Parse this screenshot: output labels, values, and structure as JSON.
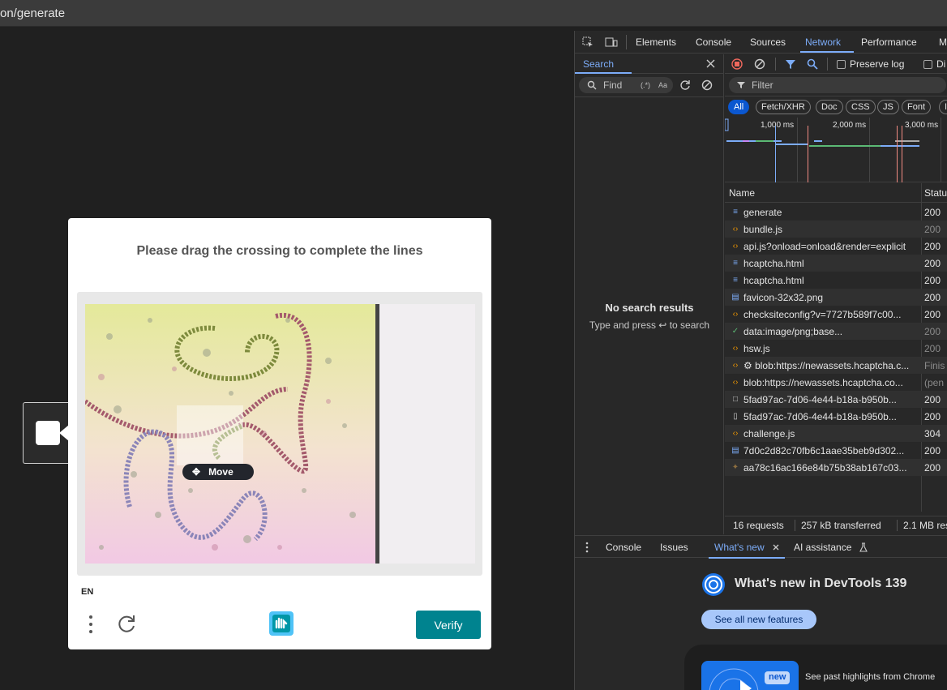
{
  "browser": {
    "url": "on/generate"
  },
  "captcha": {
    "prompt": "Please drag the crossing to complete the lines",
    "move_tooltip": "Move",
    "language": "EN",
    "verify_label": "Verify"
  },
  "devtools": {
    "tabs": [
      "Elements",
      "Console",
      "Sources",
      "Network",
      "Performance",
      "M"
    ],
    "active_tab": "Network",
    "search": {
      "title": "Search",
      "find_placeholder": "Find",
      "regex_label": "(.*)",
      "case_label": "Aa",
      "empty_title": "No search results",
      "empty_hint": "Type and press ↩ to search"
    },
    "network": {
      "preserve_log": "Preserve log",
      "disable_cache": "Di",
      "filter_placeholder": "Filter",
      "types": [
        "All",
        "Fetch/XHR",
        "Doc",
        "CSS",
        "JS",
        "Font",
        "Im"
      ],
      "timeline_labels": [
        "1,000 ms",
        "2,000 ms",
        "3,000 ms"
      ],
      "columns": {
        "name": "Name",
        "status": "Statu"
      },
      "requests": [
        {
          "name": "generate",
          "status": "200",
          "icon": "document-icon",
          "dim": false
        },
        {
          "name": "bundle.js",
          "status": "200",
          "icon": "script-icon",
          "dim": true
        },
        {
          "name": "api.js?onload=onload&render=explicit",
          "status": "200",
          "icon": "script-icon",
          "dim": false
        },
        {
          "name": "hcaptcha.html",
          "status": "200",
          "icon": "document-icon",
          "dim": false
        },
        {
          "name": "hcaptcha.html",
          "status": "200",
          "icon": "document-icon",
          "dim": false
        },
        {
          "name": "favicon-32x32.png",
          "status": "200",
          "icon": "image-icon",
          "dim": false
        },
        {
          "name": "checksiteconfig?v=7727b589f7c00...",
          "status": "200",
          "icon": "fetch-icon",
          "dim": false
        },
        {
          "name": "data:image/png;base...",
          "status": "200",
          "icon": "check-icon",
          "dim": true
        },
        {
          "name": "hsw.js",
          "status": "200",
          "icon": "script-icon",
          "dim": true
        },
        {
          "name": "⚙ blob:https://newassets.hcaptcha.c...",
          "status": "Finis",
          "icon": "script-icon",
          "dim": true
        },
        {
          "name": "blob:https://newassets.hcaptcha.co...",
          "status": "(pen",
          "icon": "script-icon",
          "dim": true
        },
        {
          "name": "5fad97ac-7d06-4e44-b18a-b950b...",
          "status": "200",
          "icon": "square-icon",
          "dim": false
        },
        {
          "name": "5fad97ac-7d06-4e44-b18a-b950b...",
          "status": "200",
          "icon": "file-icon",
          "dim": false
        },
        {
          "name": "challenge.js",
          "status": "304",
          "icon": "script-icon",
          "dim": false
        },
        {
          "name": "7d0c2d82c70fb6c1aae35beb9d302...",
          "status": "200",
          "icon": "image-icon",
          "dim": false
        },
        {
          "name": "aa78c16ac166e84b75b38ab167c03...",
          "status": "200",
          "icon": "plugin-icon",
          "dim": false
        }
      ],
      "summary": {
        "requests": "16 requests",
        "transferred": "257 kB transferred",
        "resources": "2.1 MB res"
      }
    },
    "drawer": {
      "tabs": [
        "Console",
        "Issues",
        "What's new",
        "AI assistance"
      ],
      "active_tab": "What's new",
      "whats_new_title": "What's new in DevTools 139",
      "see_all_label": "See all new features",
      "new_badge": "new",
      "highlight_text": "See past highlights from Chrome"
    }
  },
  "colors": {
    "accent": "#7cacf8",
    "verify": "#00838f",
    "devtools_bg": "#282828"
  }
}
